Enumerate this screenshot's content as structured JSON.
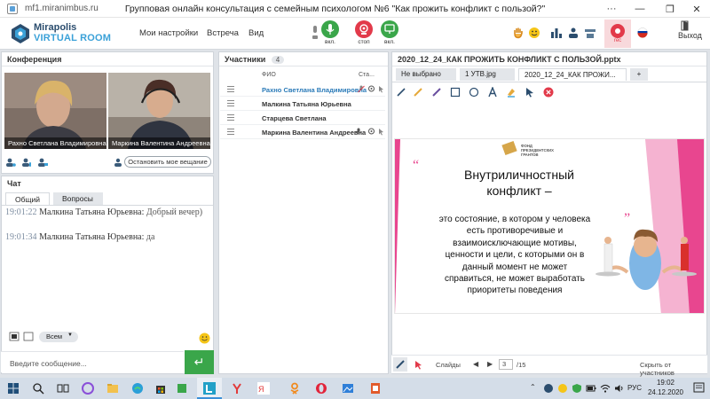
{
  "window": {
    "url": "mf1.miranimbus.ru",
    "title": "Групповая онлайн консультация с семейным психологом №6 \"Как прожить конфликт с пользой?\""
  },
  "header": {
    "logo_line1": "Mirapolis",
    "logo_line2": "VIRTUAL ROOM",
    "menu": [
      "Мои настройки",
      "Встреча",
      "Вид"
    ],
    "mic_label": "вкл.",
    "stop_label": "стоп",
    "cam_label": "вкл.",
    "rec_label": "rec",
    "exit_label": "Выход"
  },
  "conference": {
    "title": "Конференция",
    "videos": [
      {
        "name": "Рахно Светлана  Владимировна"
      },
      {
        "name": "Маркина Валентина  Андреевна"
      }
    ],
    "stop_button": "Остановить мое вещание"
  },
  "chat": {
    "title": "Чат",
    "tabs": [
      "Общий",
      "Вопросы"
    ],
    "messages": [
      {
        "time": "19:01:22",
        "author": "Малкина Татьяна  Юрьевна:",
        "text": "Добрый вечер)"
      },
      {
        "time": "19:01:34",
        "author": "Малкина Татьяна  Юрьевна:",
        "text": "да"
      }
    ],
    "recipient": "Всем",
    "input_placeholder": "Введите сообщение..."
  },
  "participants": {
    "title": "Участники",
    "count": "4",
    "col_name": "ФИО",
    "col_status": "Ста...",
    "list": [
      {
        "name": "Рахно Светлана  Владимировна"
      },
      {
        "name": "Малкина Татьяна  Юрьевна"
      },
      {
        "name": "Старцева  Светлана"
      },
      {
        "name": "Маркина Валентина  Андреевна"
      }
    ]
  },
  "presentation": {
    "title": "2020_12_24_КАК ПРОЖИТЬ КОНФЛИКТ С ПОЛЬЗОЙ.pptx",
    "tabs": [
      "Не выбрано",
      "1 УТВ.jpg",
      "2020_12_24_КАК ПРОЖИ...",
      "+"
    ],
    "slide": {
      "org": "ФОНД ПРЕЗИДЕНТСКИХ ГРАНТОВ",
      "heading_line1": "Внутриличностный",
      "heading_line2": "конфликт –",
      "body": [
        "это состояние, в котором у человека",
        "есть противоречивые и",
        "взаимоисключающие мотивы,",
        "ценности и цели, с которыми он в",
        "данный момент не может",
        "справиться, не может выработать",
        "приоритеты поведения"
      ]
    },
    "slides_label": "Слайды",
    "page_current": "3",
    "page_total": "/15",
    "hide_label": "Скрыть от участников"
  },
  "taskbar": {
    "lang": "РУС",
    "time": "19:02",
    "date": "24.12.2020"
  },
  "colors": {
    "accent_blue": "#3aa1d8",
    "green": "#3aa64a",
    "red": "#e23a4a",
    "pink": "#e8468f"
  }
}
